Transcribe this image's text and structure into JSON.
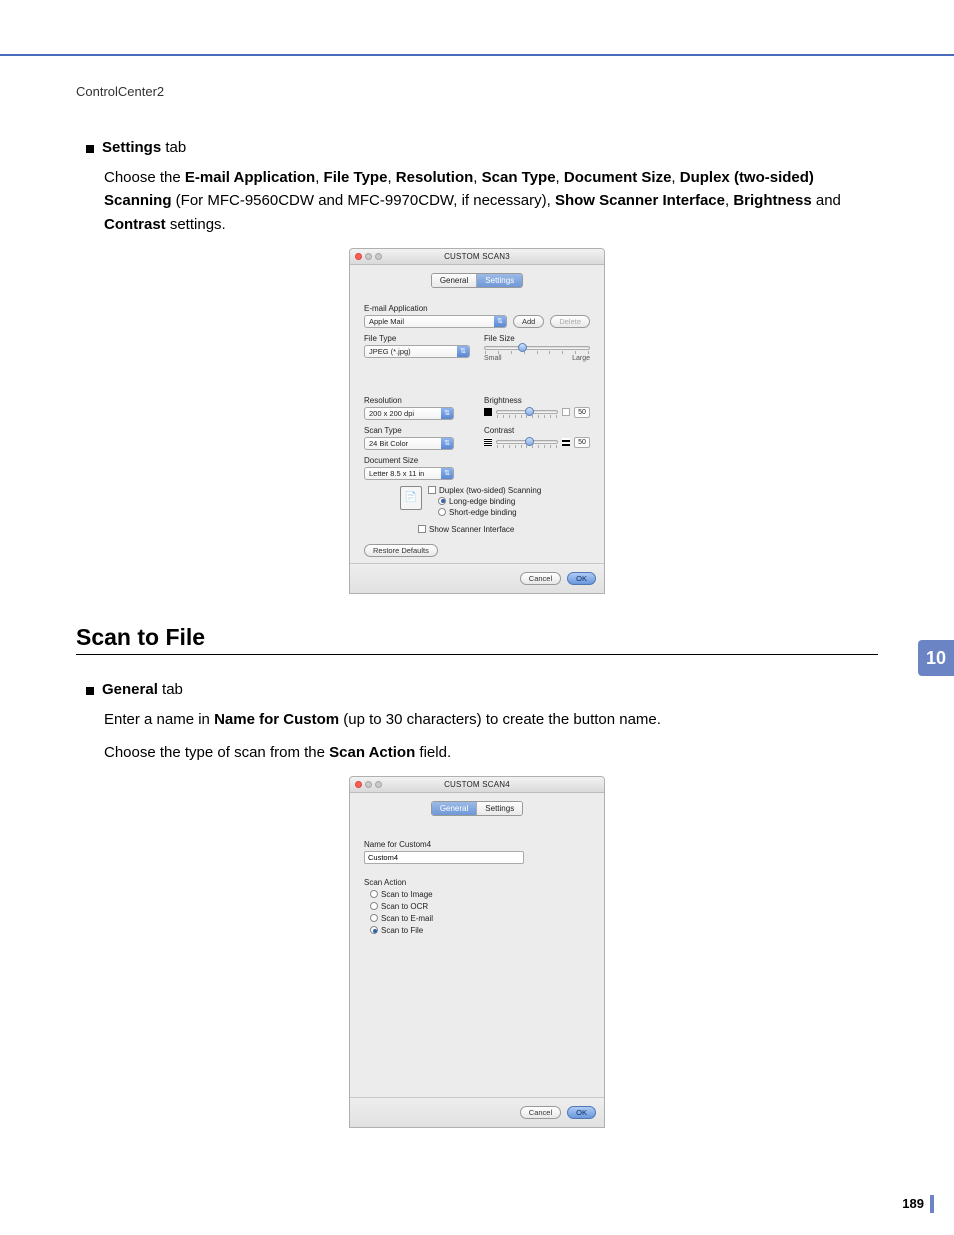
{
  "header": {
    "text": "ControlCenter2"
  },
  "section1": {
    "bullet_bold": "Settings",
    "bullet_rest": " tab",
    "body_parts": [
      "Choose the ",
      "E-mail Application",
      ", ",
      "File Type",
      ", ",
      "Resolution",
      ", ",
      "Scan Type",
      ", ",
      "Document Size",
      ", ",
      "Duplex (two-sided) Scanning",
      " (For MFC-9560CDW and MFC-9970CDW, if necessary), ",
      "Show Scanner Interface",
      ", ",
      "Brightness",
      " and ",
      "Contrast",
      " settings."
    ]
  },
  "dialog1": {
    "title": "CUSTOM SCAN3",
    "tab_general": "General",
    "tab_settings": "Settings",
    "lbl_email_app": "E-mail Application",
    "val_email_app": "Apple Mail",
    "btn_add": "Add",
    "btn_delete": "Delete",
    "lbl_file_type": "File Type",
    "val_file_type": "JPEG (*.jpg)",
    "lbl_file_size": "File Size",
    "file_size_small": "Small",
    "file_size_large": "Large",
    "lbl_resolution": "Resolution",
    "val_resolution": "200 x 200 dpi",
    "lbl_scan_type": "Scan Type",
    "val_scan_type": "24 Bit Color",
    "lbl_doc_size": "Document Size",
    "val_doc_size": "Letter  8.5 x 11 in",
    "lbl_brightness": "Brightness",
    "val_brightness": "50",
    "lbl_contrast": "Contrast",
    "val_contrast": "50",
    "chk_duplex": "Duplex (two-sided) Scanning",
    "radio_long": "Long-edge binding",
    "radio_short": "Short-edge binding",
    "chk_show_if": "Show Scanner Interface",
    "btn_restore": "Restore Defaults",
    "btn_cancel": "Cancel",
    "btn_ok": "OK"
  },
  "section2": {
    "title": "Scan to File",
    "bullet_bold": "General",
    "bullet_rest": " tab",
    "body1_a": "Enter a name in ",
    "body1_b": "Name for Custom",
    "body1_c": " (up to 30 characters) to create the button name.",
    "body2_a": "Choose the type of scan from the ",
    "body2_b": "Scan Action",
    "body2_c": " field."
  },
  "dialog2": {
    "title": "CUSTOM SCAN4",
    "tab_general": "General",
    "tab_settings": "Settings",
    "lbl_name": "Name for Custom4",
    "val_name": "Custom4",
    "lbl_action": "Scan Action",
    "opt_image": "Scan to Image",
    "opt_ocr": "Scan to OCR",
    "opt_email": "Scan to E-mail",
    "opt_file": "Scan to File",
    "btn_cancel": "Cancel",
    "btn_ok": "OK"
  },
  "chapter_num": "10",
  "page_num": "189"
}
